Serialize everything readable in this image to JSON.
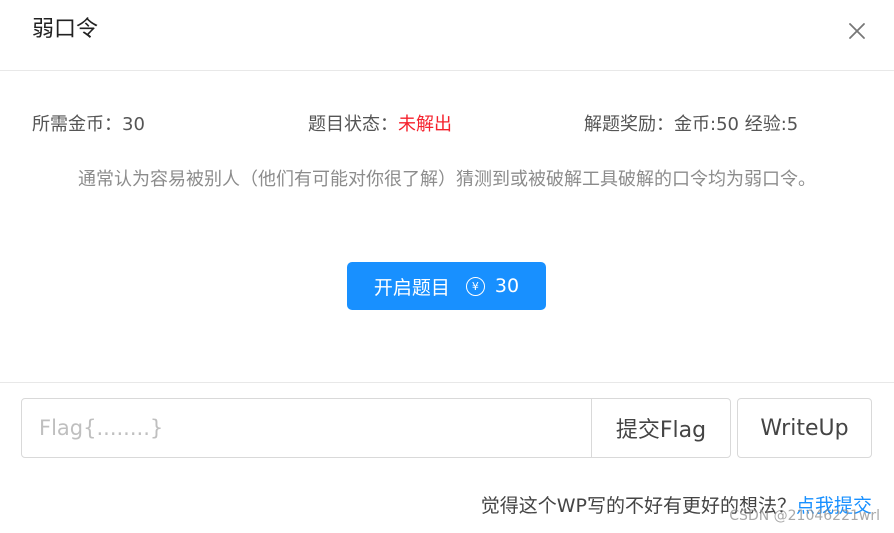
{
  "dialog": {
    "title": "弱口令",
    "close_icon": "close-icon"
  },
  "info": {
    "coins_label": "所需金币：",
    "coins_value": "30",
    "status_label": "题目状态：",
    "status_value": "未解出",
    "reward_label": "解题奖励：",
    "reward_value": "金币:50 经验:5"
  },
  "description": "通常认为容易被别人（他们有可能对你很了解）猜测到或被破解工具破解的口令均为弱口令。",
  "start_button": {
    "label": "开启题目",
    "coin_symbol": "¥",
    "cost": "30",
    "color": "#1890ff"
  },
  "flag_form": {
    "placeholder": "Flag{........}",
    "value": "",
    "submit_label": "提交Flag",
    "writeup_label": "WriteUp"
  },
  "footer": {
    "prompt": "觉得这个WP写的不好有更好的想法？",
    "link_label": "点我提交"
  },
  "watermark": "CSDN @21046221wrl",
  "colors": {
    "accent": "#1890ff",
    "status_unsolved": "#f5222d"
  }
}
